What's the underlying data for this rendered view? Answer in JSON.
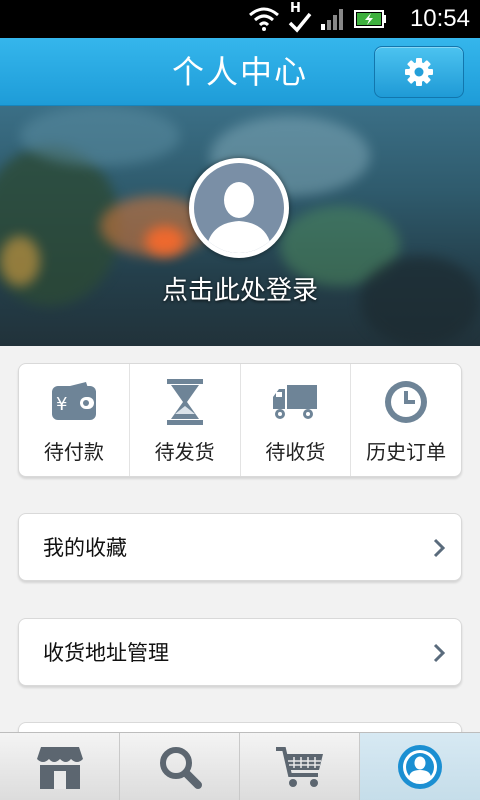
{
  "status_bar": {
    "time": "10:54",
    "network_label": "H",
    "icons": [
      "wifi-icon",
      "network-h-icon",
      "signal-icon",
      "battery-charging-icon"
    ]
  },
  "header": {
    "title": "个人中心",
    "settings_icon": "gear-icon"
  },
  "banner": {
    "login_text": "点击此处登录",
    "avatar_icon": "default-avatar-icon"
  },
  "orders": [
    {
      "label": "待付款",
      "icon": "wallet-icon",
      "icon_text": "¥"
    },
    {
      "label": "待发货",
      "icon": "hourglass-icon"
    },
    {
      "label": "待收货",
      "icon": "truck-icon"
    },
    {
      "label": "历史订单",
      "icon": "clock-icon"
    }
  ],
  "menu": [
    {
      "label": "我的收藏"
    },
    {
      "label": "收货地址管理"
    },
    {
      "label": ""
    }
  ],
  "tabs": [
    {
      "icon": "store-icon",
      "active": false
    },
    {
      "icon": "search-icon",
      "active": false
    },
    {
      "icon": "cart-icon",
      "active": false
    },
    {
      "icon": "user-profile-icon",
      "active": true
    }
  ],
  "colors": {
    "header": "#26a8e2",
    "icon_gray": "#6e8497",
    "accent_blue": "#1b8fd2"
  }
}
